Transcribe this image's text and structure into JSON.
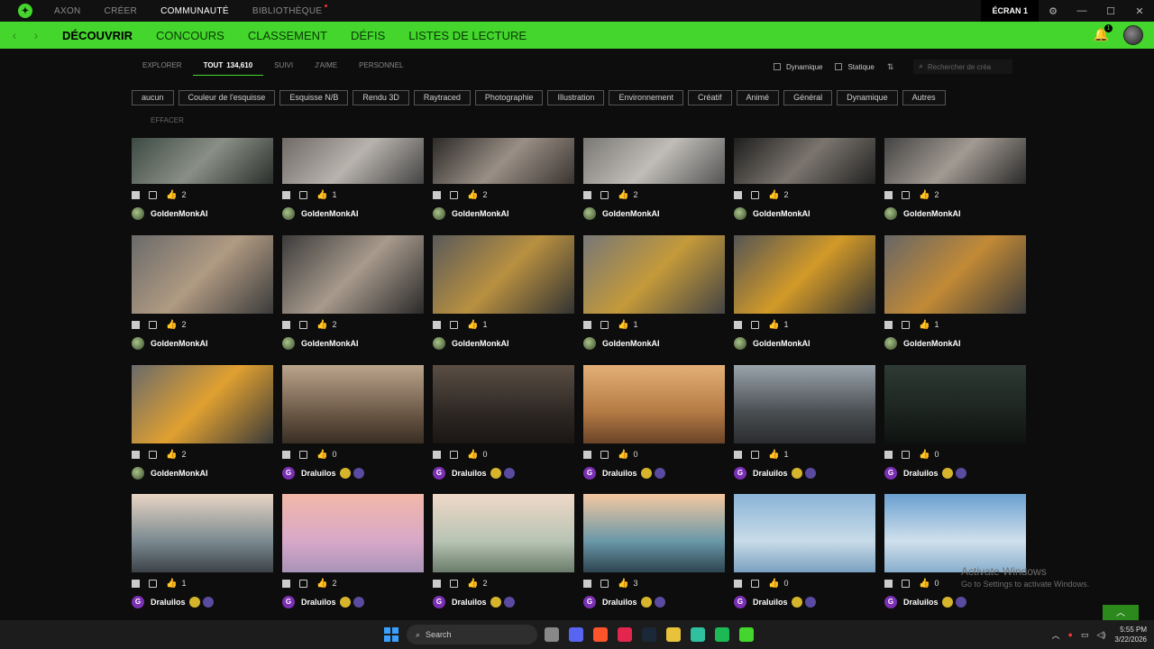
{
  "titlebar": {
    "nav": [
      "AXON",
      "CRÉER",
      "COMMUNAUTÉ",
      "BIBLIOTHÈQUE"
    ],
    "active_index": 2,
    "screen_label": "ÉCRAN 1"
  },
  "main_tabs": [
    "DÉCOUVRIR",
    "CONCOURS",
    "CLASSEMENT",
    "DÉFIS",
    "LISTES DE LECTURE"
  ],
  "notification_count": "1",
  "subnav": {
    "explore": "EXPLORER",
    "all": "TOUT",
    "all_count": "134,610",
    "followed": "SUIVI",
    "liked": "J'AIME",
    "personal": "PERSONNEL"
  },
  "filters": {
    "dynamic": "Dynamique",
    "static": "Statique",
    "search_placeholder": "Rechercher de créa"
  },
  "chips": [
    "aucun",
    "Couleur de l'esquisse",
    "Esquisse N/B",
    "Rendu 3D",
    "Raytraced",
    "Photographie",
    "Illustration",
    "Environnement",
    "Créatif",
    "Animé",
    "Général",
    "Dynamique",
    "Autres"
  ],
  "clear_label": "EFFACER",
  "cards": [
    {
      "likes": "2",
      "author": "GoldenMonkAI",
      "badges": false
    },
    {
      "likes": "1",
      "author": "GoldenMonkAI",
      "badges": false
    },
    {
      "likes": "2",
      "author": "GoldenMonkAI",
      "badges": false
    },
    {
      "likes": "2",
      "author": "GoldenMonkAI",
      "badges": false
    },
    {
      "likes": "2",
      "author": "GoldenMonkAI",
      "badges": false
    },
    {
      "likes": "2",
      "author": "GoldenMonkAI",
      "badges": false
    },
    {
      "likes": "2",
      "author": "GoldenMonkAI",
      "badges": false
    },
    {
      "likes": "2",
      "author": "GoldenMonkAI",
      "badges": false
    },
    {
      "likes": "1",
      "author": "GoldenMonkAI",
      "badges": false
    },
    {
      "likes": "1",
      "author": "GoldenMonkAI",
      "badges": false
    },
    {
      "likes": "1",
      "author": "GoldenMonkAI",
      "badges": false
    },
    {
      "likes": "1",
      "author": "GoldenMonkAI",
      "badges": false
    },
    {
      "likes": "2",
      "author": "GoldenMonkAI",
      "badges": false
    },
    {
      "likes": "0",
      "author": "Draluilos",
      "badges": true
    },
    {
      "likes": "0",
      "author": "Draluilos",
      "badges": true
    },
    {
      "likes": "0",
      "author": "Draluilos",
      "badges": true
    },
    {
      "likes": "1",
      "author": "Draluilos",
      "badges": true
    },
    {
      "likes": "0",
      "author": "Draluilos",
      "badges": true
    },
    {
      "likes": "1",
      "author": "Draluilos",
      "badges": true
    },
    {
      "likes": "2",
      "author": "Draluilos",
      "badges": true
    },
    {
      "likes": "2",
      "author": "Draluilos",
      "badges": true
    },
    {
      "likes": "3",
      "author": "Draluilos",
      "badges": true
    },
    {
      "likes": "0",
      "author": "Draluilos",
      "badges": true
    },
    {
      "likes": "0",
      "author": "Draluilos",
      "badges": true
    }
  ],
  "author_initial": "G",
  "watermark": {
    "line1": "Activate Windows",
    "line2": "Go to Settings to activate Windows."
  },
  "taskbar": {
    "search": "Search",
    "time": "5:55 PM",
    "date": "3/22/2026"
  },
  "colors": {
    "accent": "#44d62c",
    "background": "#0d0d0d"
  }
}
